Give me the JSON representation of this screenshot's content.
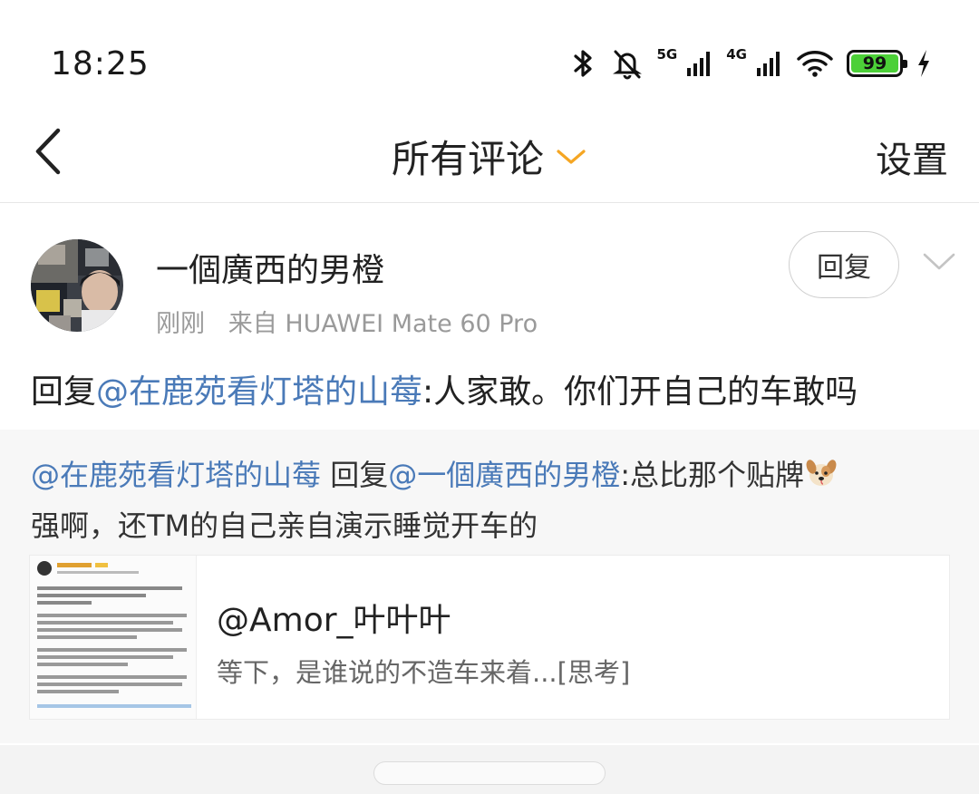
{
  "status_bar": {
    "time": "18:25",
    "network_5g": "5G",
    "network_4g": "4G",
    "battery": "99",
    "icons": [
      "bluetooth-icon",
      "mute-bell-icon",
      "signal-5g-icon",
      "signal-4g-icon",
      "wifi-icon",
      "battery-icon",
      "charging-icon"
    ]
  },
  "nav": {
    "title": "所有评论",
    "settings": "设置",
    "accent_color": "#f5a623"
  },
  "comment": {
    "username": "一個廣西的男橙",
    "time": "刚刚",
    "source": "来自 HUAWEI Mate 60 Pro",
    "reply_button": "回复",
    "text_prefix": "回复",
    "text_mention": "@在鹿苑看灯塔的山莓",
    "text_body": ":人家敢。你们开自己的车敢吗",
    "mention_color": "#4a7ab8"
  },
  "quoted": {
    "mention_author": "@在鹿苑看灯塔的山莓",
    "reply_word": " 回复",
    "mention_target": "@一個廣西的男橙",
    "text_part1": ":总比那个贴牌",
    "emoji": "dog-icon",
    "text_part2": "强啊，还TM的自己亲自演示睡觉开车的",
    "card": {
      "title": "@Amor_叶叶叶",
      "description": "等下，是谁说的不造车来着...[思考]"
    }
  }
}
